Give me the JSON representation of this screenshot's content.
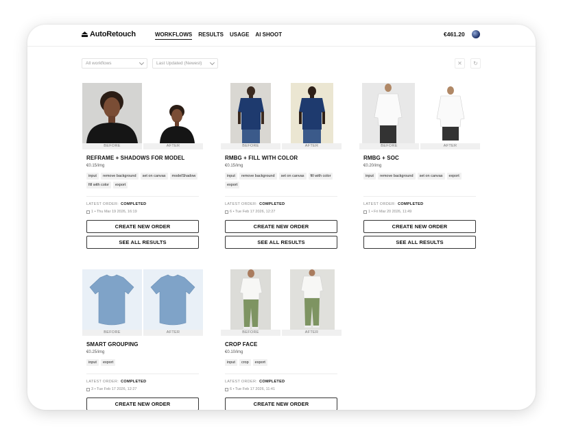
{
  "app": {
    "brand": "AutoRetouch",
    "balance": "€461.20"
  },
  "nav": [
    {
      "label": "WORKFLOWS",
      "active": true
    },
    {
      "label": "RESULTS"
    },
    {
      "label": "USAGE"
    },
    {
      "label": "AI SHOOT"
    }
  ],
  "filters": {
    "workflow_value": "All workflows",
    "sort_value": "Last Updated (Newest)"
  },
  "labels": {
    "before": "BEFORE",
    "after": "AFTER",
    "latest_order": "LATEST ORDER:",
    "create": "CREATE NEW ORDER",
    "see_all": "SEE ALL RESULTS"
  },
  "workflows": [
    {
      "title": "REFRAME + SHADOWS FOR MODEL",
      "price": "€0.15/img",
      "tags": [
        "input",
        "remove background",
        "set on canvas",
        "modelShadow",
        "fill with color",
        "export"
      ],
      "status": "COMPLETED",
      "meta": "1 • Thu Mar 19 2026, 16:19"
    },
    {
      "title": "RMBG + FILL WITH COLOR",
      "price": "€0.15/img",
      "tags": [
        "input",
        "remove background",
        "set on canvas",
        "fill with color",
        "export"
      ],
      "status": "COMPLETED",
      "meta": "6 • Tue Feb 17 2026, 12:27"
    },
    {
      "title": "RMBG + SOC",
      "price": "€0.20/img",
      "tags": [
        "input",
        "remove background",
        "set on canvas",
        "export"
      ],
      "status": "COMPLETED",
      "meta": "1 • Fri Mar 20 2026, 11:49"
    },
    {
      "title": "SMART GROUPING",
      "price": "€0.25/img",
      "tags": [
        "input",
        "export"
      ],
      "status": "COMPLETED",
      "meta": "3 • Tue Feb 17 2026, 12:27"
    },
    {
      "title": "CROP FACE",
      "price": "€0.10/img",
      "tags": [
        "input",
        "crop",
        "export"
      ],
      "status": "COMPLETED",
      "meta": "6 • Tue Feb 17 2026, 11:41"
    }
  ]
}
